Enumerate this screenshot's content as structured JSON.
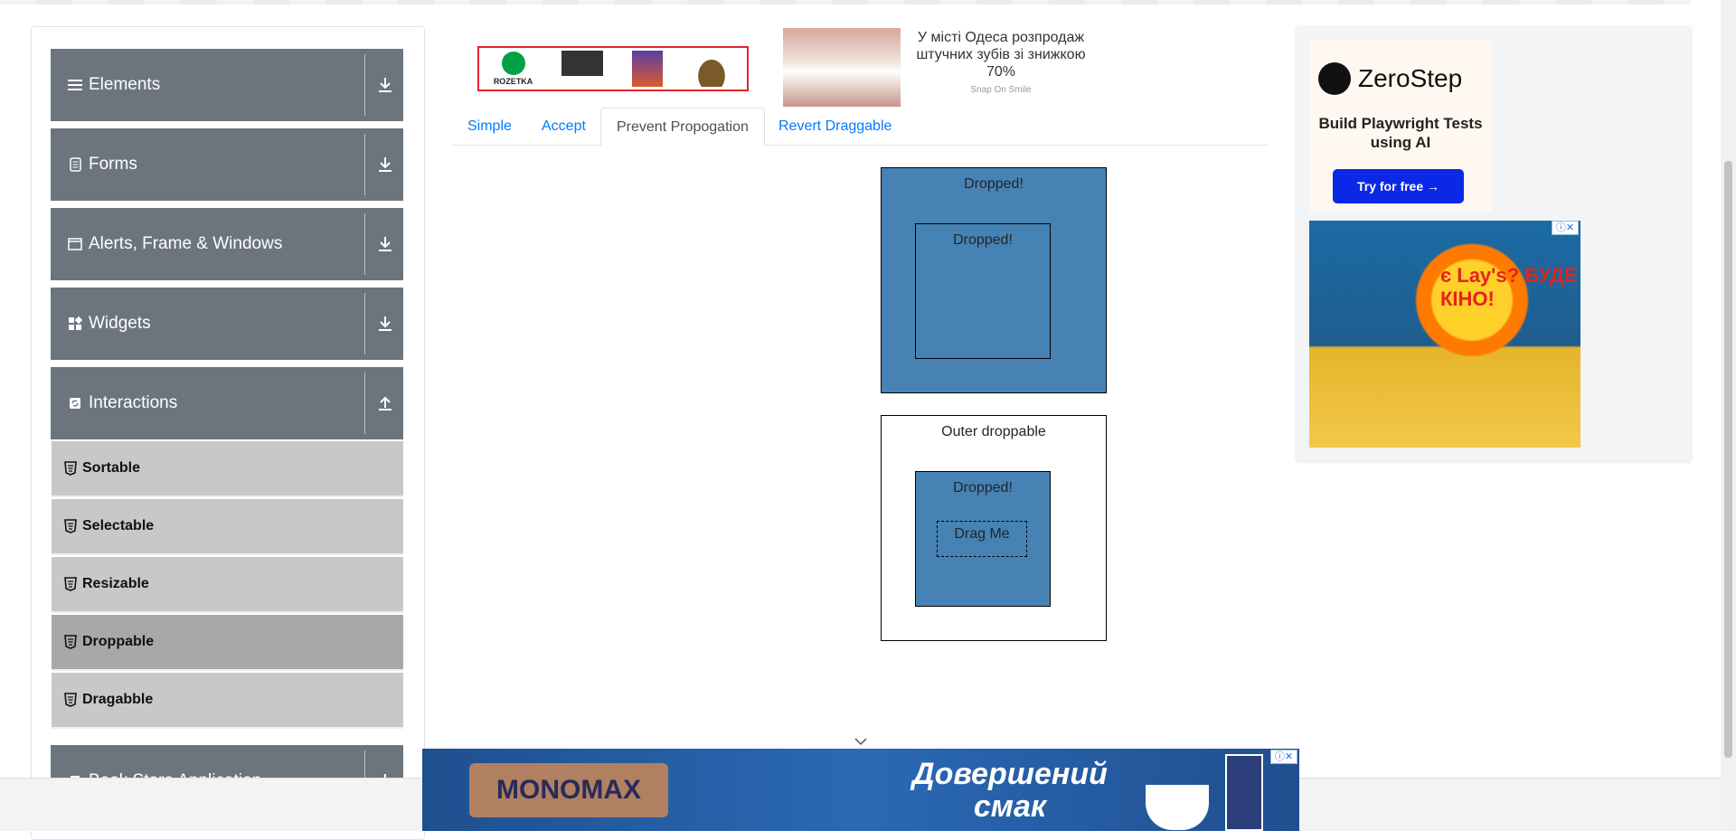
{
  "sidebar": {
    "groups": [
      {
        "label": "Elements",
        "icon": "hamburger-icon",
        "arrow": "download-arrow-icon"
      },
      {
        "label": "Forms",
        "icon": "document-icon",
        "arrow": "download-arrow-icon"
      },
      {
        "label": "Alerts, Frame & Windows",
        "icon": "window-icon",
        "arrow": "download-arrow-icon"
      },
      {
        "label": "Widgets",
        "icon": "grid-icon",
        "arrow": "download-arrow-icon"
      },
      {
        "label": "Interactions",
        "icon": "refresh-icon",
        "arrow": "upload-arrow-icon"
      },
      {
        "label": "Book Store Application",
        "icon": "book-icon",
        "arrow": "download-arrow-icon"
      }
    ],
    "interaction_items": [
      {
        "label": "Sortable"
      },
      {
        "label": "Selectable"
      },
      {
        "label": "Resizable"
      },
      {
        "label": "Droppable",
        "active": true
      },
      {
        "label": "Dragabble"
      }
    ]
  },
  "tabs": [
    {
      "label": "Simple"
    },
    {
      "label": "Accept"
    },
    {
      "label": "Prevent Propogation",
      "active": true
    },
    {
      "label": "Revert Draggable"
    }
  ],
  "droppable": {
    "greedy_outer": "Dropped!",
    "greedy_inner": "Dropped!",
    "outer": "Outer droppable",
    "inner": "Dropped!",
    "drag_me": "Drag Me"
  },
  "ads": {
    "rozetka_label": "ROZETKA",
    "teeth_text": "У місті Одеса розпродаж штучних зубів зі знижкою 70%",
    "teeth_source": "Snap On Smile",
    "zerostep_name": "ZeroStep",
    "zerostep_tagline": "Build Playwright Tests using AI",
    "zerostep_button": "Try for free →",
    "lays_text": "є Lay's? БУДЕ КІНО!",
    "monomax_brand": "MONOMAX",
    "monomax_slogan": "Довершений смак"
  },
  "colors": {
    "sidebar_header": "#6c757d",
    "sidebar_item": "#c8c8c8",
    "sidebar_item_active": "#a8a8a8",
    "tab_link": "#007bff",
    "droppable_blue": "#4682b4",
    "zerostep_button": "#0b28e6"
  }
}
